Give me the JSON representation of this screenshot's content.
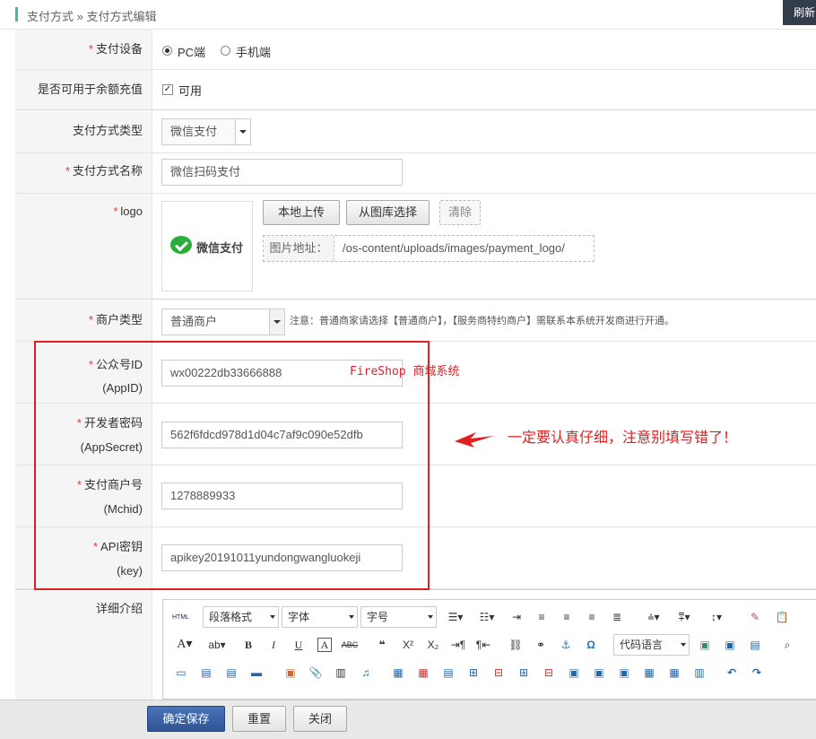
{
  "header": {
    "breadcrumb": "支付方式 » 支付方式编辑",
    "refresh_label": "刷新"
  },
  "form": {
    "device": {
      "label": "支付设备",
      "options": [
        "PC端",
        "手机端"
      ],
      "selected": "PC端"
    },
    "recharge": {
      "label": "是否可用于余额充值",
      "checkbox_label": "可用",
      "checked": true
    },
    "type": {
      "label": "支付方式类型",
      "value": "微信支付"
    },
    "name": {
      "label": "支付方式名称",
      "value": "微信扫码支付"
    },
    "logo": {
      "label": "logo",
      "preview_text": "微信支付",
      "upload_label": "本地上传",
      "gallery_label": "从图库选择",
      "clear_label": "清除",
      "url_label": "图片地址：",
      "url_value": "/os-content/uploads/images/payment_logo/"
    },
    "merchant_type": {
      "label": "商户类型",
      "value": "普通商户",
      "note": "注意：普通商家请选择【普通商户】，【服务商特约商户】需联系本系统开发商进行开通。"
    },
    "appid": {
      "label": "公众号ID",
      "sub": "(AppID)",
      "value": "wx00222db33666888"
    },
    "appsecret": {
      "label": "开发者密码",
      "sub": "(AppSecret)",
      "value": "562f6fdcd978d1d04c7af9c090e52dfb"
    },
    "mchid": {
      "label": "支付商户号",
      "sub": "(Mchid)",
      "value": "1278889933"
    },
    "apikey": {
      "label": "API密钥",
      "sub": "(key)",
      "value": "apikey20191011yundongwangluokeji"
    },
    "detail": {
      "label": "详细介绍"
    }
  },
  "editor": {
    "html_label": "HTML",
    "paragraph_label": "段落格式",
    "font_label": "字体",
    "size_label": "字号",
    "code_lang_label": "代码语言"
  },
  "annotations": {
    "watermark": "FireShop 商城系统",
    "warning": "一定要认真仔细，注意别填写错了！",
    "accent_color": "#e02020"
  },
  "footer": {
    "save_label": "确定保存",
    "reset_label": "重置",
    "close_label": "关闭"
  }
}
